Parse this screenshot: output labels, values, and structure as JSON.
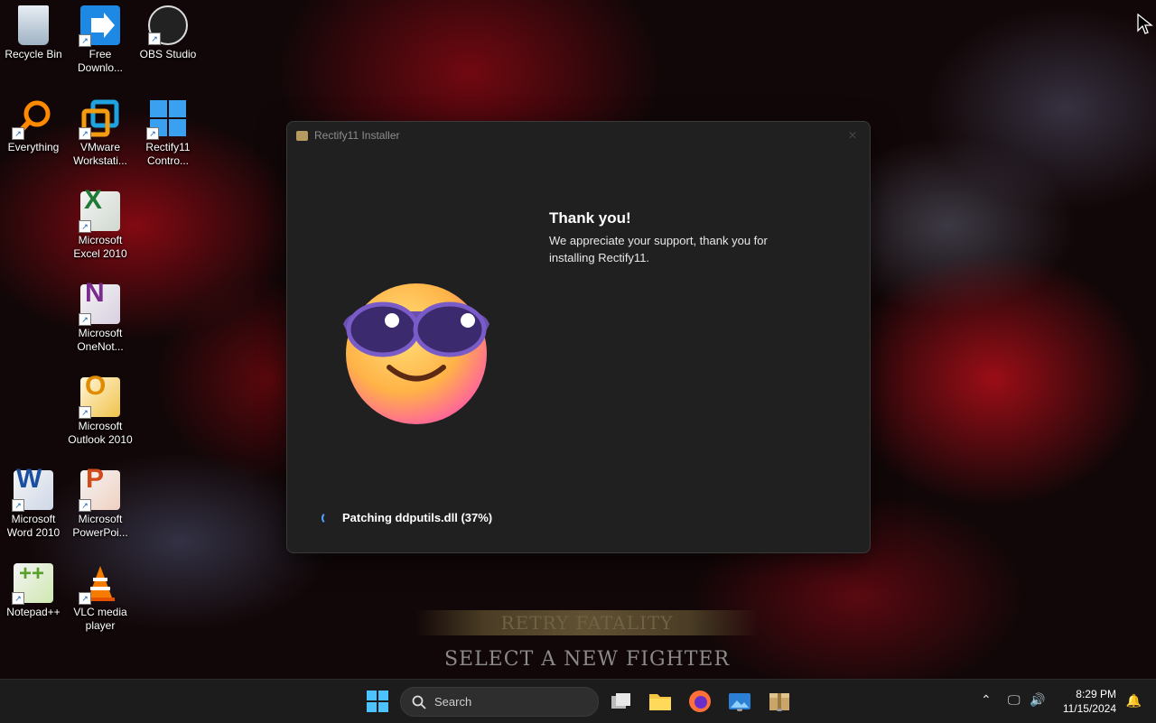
{
  "desktop": {
    "icons": [
      {
        "label": "Recycle Bin",
        "icon": "recycle-bin-icon"
      },
      {
        "label": "Free Downlo...",
        "icon": "free-download-manager-icon"
      },
      {
        "label": "OBS Studio",
        "icon": "obs-studio-icon"
      },
      {
        "label": "Everything",
        "icon": "everything-search-icon"
      },
      {
        "label": "VMware Workstati...",
        "icon": "vmware-icon"
      },
      {
        "label": "Rectify11 Contro...",
        "icon": "rectify11-icon"
      },
      {
        "label": "Microsoft Excel 2010",
        "icon": "excel-icon"
      },
      {
        "label": "Microsoft OneNot...",
        "icon": "onenote-icon"
      },
      {
        "label": "Microsoft Outlook 2010",
        "icon": "outlook-icon"
      },
      {
        "label": "Microsoft Word 2010",
        "icon": "word-icon"
      },
      {
        "label": "Microsoft PowerPoi...",
        "icon": "powerpoint-icon"
      },
      {
        "label": "Notepad++",
        "icon": "notepadpp-icon"
      },
      {
        "label": "VLC media player",
        "icon": "vlc-icon"
      }
    ]
  },
  "wallpaper": {
    "banner_retry": "RETRY FATALITY",
    "banner_select": "SELECT A NEW FIGHTER"
  },
  "installer": {
    "title": "Rectify11 Installer",
    "heading": "Thank you!",
    "message": "We appreciate your support, thank you for installing Rectify11.",
    "status": "Patching ddputils.dll (37%)",
    "progress_percent": 37
  },
  "taskbar": {
    "search_placeholder": "Search",
    "time": "8:29 PM",
    "date": "11/15/2024",
    "apps": [
      "start-icon",
      "task-view-icon",
      "file-explorer-icon",
      "firefox-icon",
      "photos-icon",
      "installer-icon"
    ]
  },
  "colors": {
    "window_bg": "#202020",
    "accent": "#4ea1ff",
    "taskbar_bg": "#1c1c1c"
  }
}
